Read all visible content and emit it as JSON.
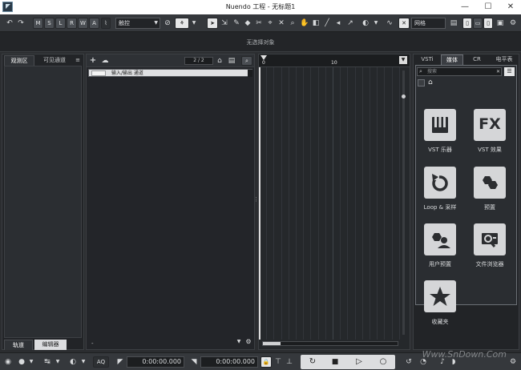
{
  "window": {
    "title": "Nuendo 工程 - 无标题1",
    "minimize": "—",
    "maximize": "☐",
    "close": "✕"
  },
  "toolbar": {
    "undo": "↶",
    "redo": "↷",
    "modes": [
      "M",
      "S",
      "L",
      "R",
      "W",
      "A"
    ],
    "automation_mode": "触控",
    "grid_label": "网格"
  },
  "infoline": {
    "text": "无选择对象"
  },
  "left_zone": {
    "tabs": [
      "观测区",
      "可见通道"
    ],
    "bottom_tabs": [
      "轨道",
      "编辑器"
    ],
    "menu_glyph": "≡"
  },
  "track_list": {
    "add_glyph": "+",
    "counter": "2 / 2",
    "tracks": [
      {
        "name": "输入/输出 通道"
      }
    ],
    "footer_mark": "-"
  },
  "project": {
    "ruler_marks": [
      "0",
      "10"
    ]
  },
  "right_zone": {
    "tabs": [
      "VSTi",
      "媒体",
      "CR",
      "电平表"
    ],
    "active_tab": "媒体",
    "search_placeholder": "搜索",
    "home_glyph": "⌂",
    "tiles": [
      {
        "label": "VST 乐器",
        "icon": "piano-icon"
      },
      {
        "label": "VST 效果",
        "icon": "fx-icon",
        "glyph": "FX"
      },
      {
        "label": "Loop & 采样",
        "icon": "loop-icon"
      },
      {
        "label": "预置",
        "icon": "preset-icon"
      },
      {
        "label": "用户预置",
        "icon": "user-preset-icon"
      },
      {
        "label": "文件浏览器",
        "icon": "file-browser-icon"
      },
      {
        "label": "收藏夹",
        "icon": "favorites-icon"
      }
    ]
  },
  "transport": {
    "aq": "AQ",
    "time_start": "0:00:00.000",
    "time_end": "0:00:00.000"
  },
  "watermark": "Www.SnDown.Com"
}
